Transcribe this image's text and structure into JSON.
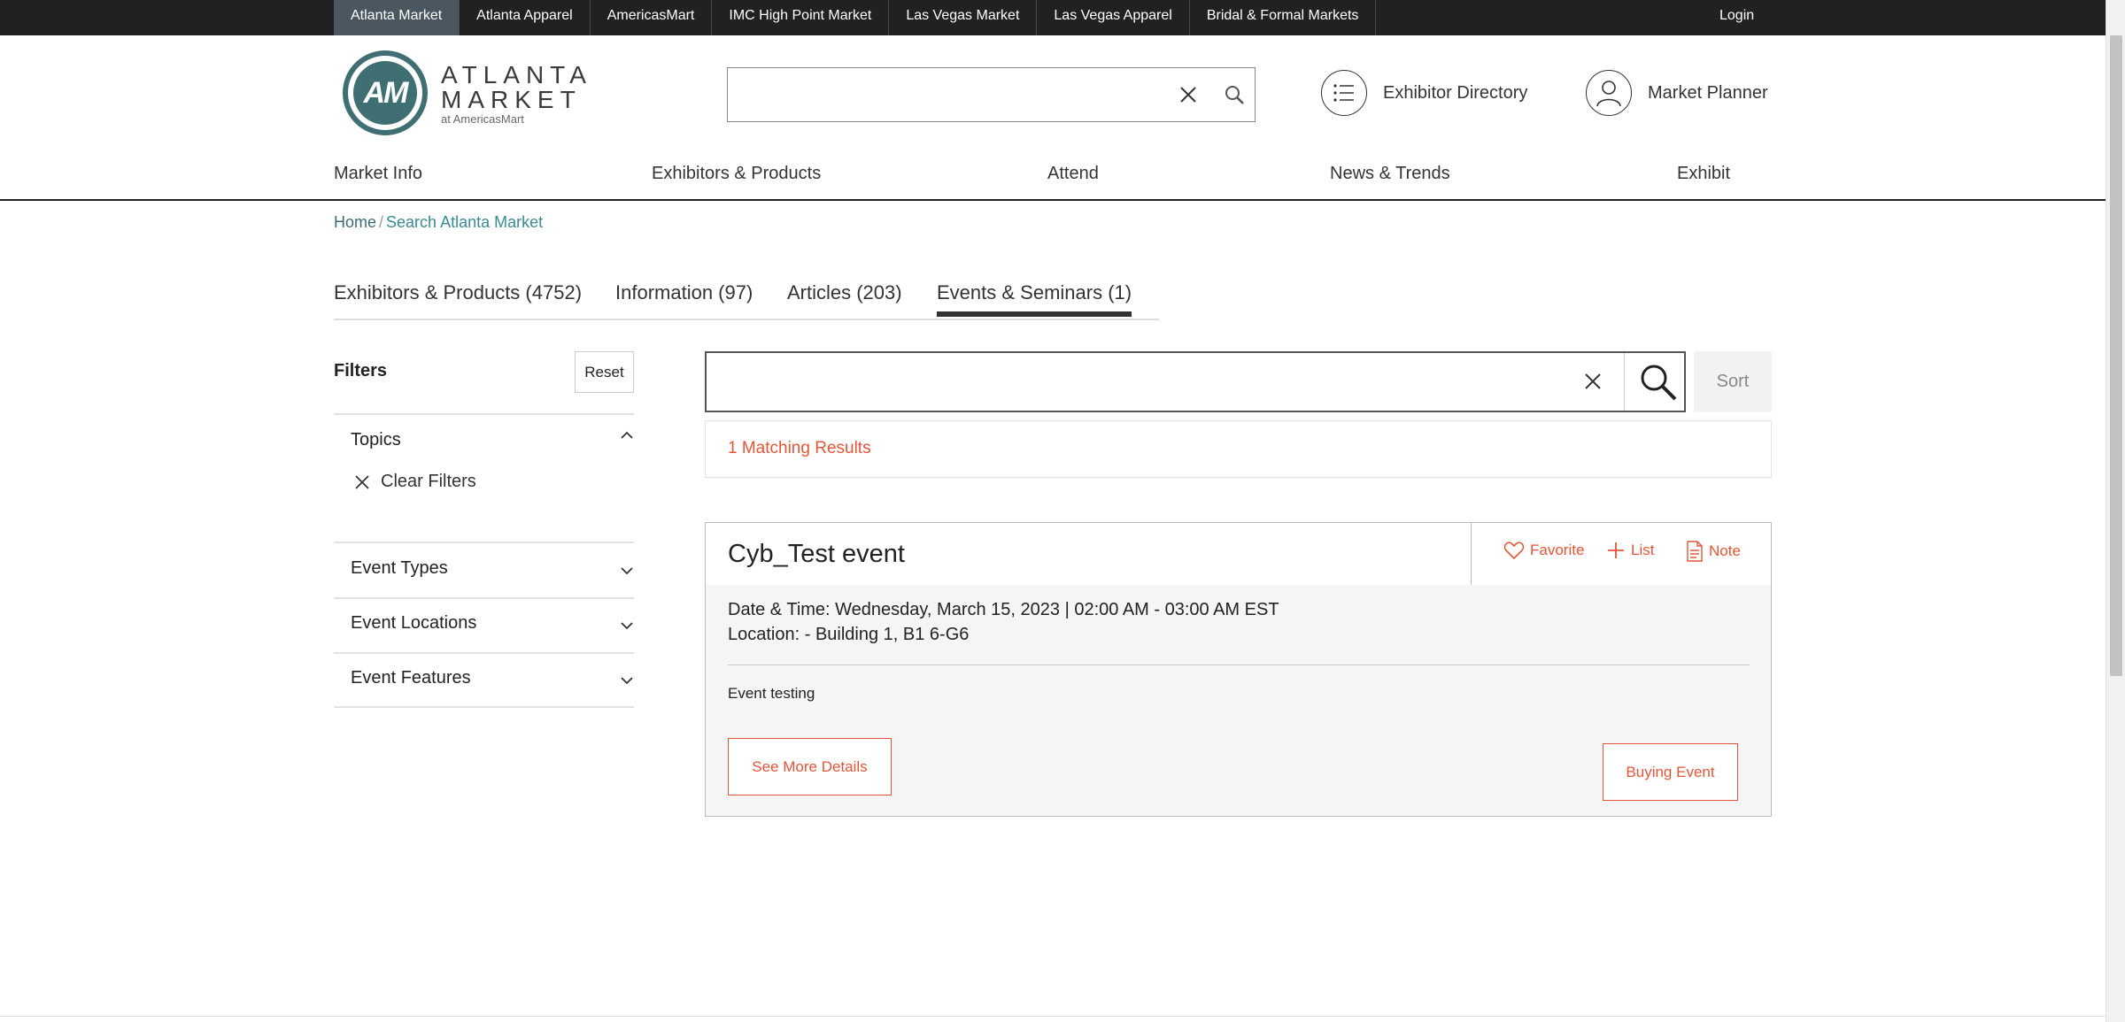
{
  "topbar": {
    "markets": [
      {
        "label": "Atlanta Market",
        "active": true
      },
      {
        "label": "Atlanta Apparel",
        "active": false
      },
      {
        "label": "AmericasMart",
        "active": false
      },
      {
        "label": "IMC High Point Market",
        "active": false
      },
      {
        "label": "Las Vegas Market",
        "active": false
      },
      {
        "label": "Las Vegas Apparel",
        "active": false
      },
      {
        "label": "Bridal & Formal Markets",
        "active": false
      }
    ],
    "login": "Login"
  },
  "logo": {
    "monogram": "AM",
    "line1": "ATLANTA",
    "line2": "MARKET",
    "sub": "at AmericasMart"
  },
  "header": {
    "search_value": "",
    "exhibitor_directory": "Exhibitor Directory",
    "market_planner": "Market Planner"
  },
  "mainnav": {
    "items": [
      "Market Info",
      "Exhibitors & Products",
      "Attend",
      "News & Trends",
      "Exhibit"
    ]
  },
  "breadcrumb": {
    "home": "Home",
    "separator": "/",
    "current": "Search Atlanta Market"
  },
  "tabs": [
    {
      "label": "Exhibitors & Products (4752)",
      "active": false
    },
    {
      "label": "Information (97)",
      "active": false
    },
    {
      "label": "Articles (203)",
      "active": false
    },
    {
      "label": "Events & Seminars (1)",
      "active": true
    }
  ],
  "filters": {
    "title": "Filters",
    "reset": "Reset",
    "sections": [
      {
        "label": "Topics",
        "expanded": true
      },
      {
        "label": "Event Types",
        "expanded": false
      },
      {
        "label": "Event Locations",
        "expanded": false
      },
      {
        "label": "Event Features",
        "expanded": false
      }
    ],
    "clear_filters": "Clear Filters"
  },
  "results": {
    "search_value": "",
    "sort": "Sort",
    "matching": "1 Matching Results"
  },
  "event": {
    "title": "Cyb_Test event",
    "favorite": "Favorite",
    "list": "List",
    "note": "Note",
    "datetime": "Date & Time: Wednesday, March 15, 2023 | 02:00 AM - 03:00 AM EST",
    "location": "Location: - Building 1, B1 6-G6",
    "description": "Event testing",
    "see_more": "See More Details",
    "buying_event": "Buying Event"
  },
  "colors": {
    "accent": "#e4563a",
    "brand_teal": "#3f6f73",
    "topbar": "#212121"
  }
}
